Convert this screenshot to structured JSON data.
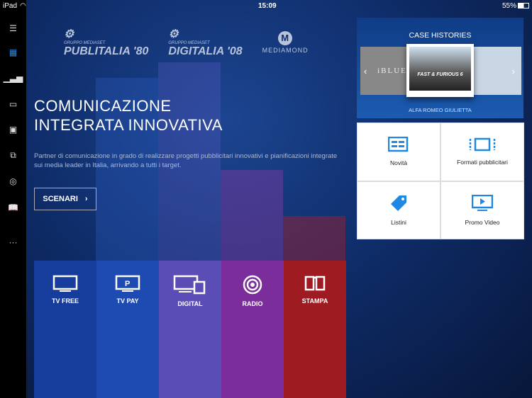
{
  "status": {
    "device": "iPad",
    "time": "15:09",
    "battery": "55%"
  },
  "logos": [
    {
      "small": "GRUPPO MEDIASET",
      "name": "PUBLITALIA '80"
    },
    {
      "small": "GRUPPO MEDIASET",
      "name": "DIGITALIA '08"
    },
    {
      "name": "MEDIAMOND"
    }
  ],
  "hero": {
    "title_line1": "COMUNICAZIONE",
    "title_line2": "INTEGRATA INNOVATIVA",
    "description": "Partner di comunicazione in grado di realizzare progetti pubblicitari innovativi e pianificazioni integrate sui media leader in Italia, arrivando a tutti i target.",
    "button": "SCENARI"
  },
  "tiles": [
    {
      "label": "TV FREE",
      "color": "#163d9c"
    },
    {
      "label": "TV PAY",
      "color": "#1d4bb2"
    },
    {
      "label": "DIGITAL",
      "color": "#5a4db6"
    },
    {
      "label": "RADIO",
      "color": "#7a2d9b"
    },
    {
      "label": "STAMPA",
      "color": "#9e1b22"
    }
  ],
  "case": {
    "title": "CASE HISTORIES",
    "caption": "ALFA ROMEO GIULIETTA",
    "left_item": "iBLUE",
    "center_item": "FAST & FURIOUS 6"
  },
  "grid": [
    {
      "label": "Novità"
    },
    {
      "label": "Formati pubblicitari"
    },
    {
      "label": "Listini"
    },
    {
      "label": "Promo Video"
    }
  ],
  "accent": "#1e88e5"
}
